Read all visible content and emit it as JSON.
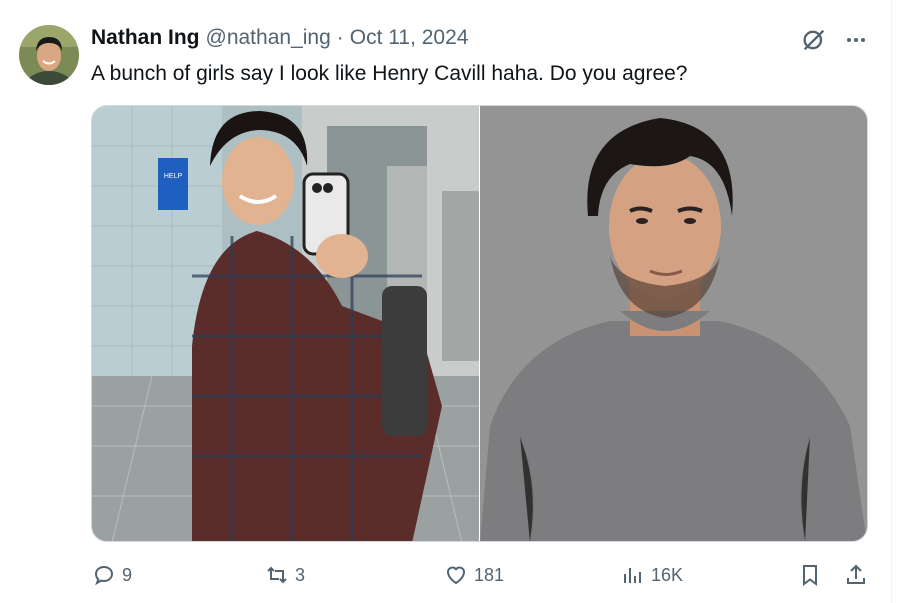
{
  "tweet": {
    "author": {
      "name": "Nathan Ing",
      "handle": "@nathan_ing",
      "separator": "·",
      "date": "Oct 11, 2024"
    },
    "text": "A bunch of girls say I look like Henry Cavill haha. Do you agree?",
    "media": [
      {
        "description_icon": "photo-selfie",
        "poster": "DO YOU NEED HELP?"
      },
      {
        "description_icon": "photo-portrait"
      }
    ],
    "metrics": {
      "replies": "9",
      "retweets": "3",
      "likes": "181",
      "views": "16K"
    }
  },
  "icons": {
    "grok": "grok-icon",
    "more": "more-icon",
    "reply": "reply-icon",
    "retweet": "retweet-icon",
    "like": "like-icon",
    "views": "views-icon",
    "bookmark": "bookmark-icon",
    "share": "share-icon"
  },
  "colors": {
    "text": "#0f1419",
    "secondary": "#536471",
    "border": "#cfd9de"
  }
}
